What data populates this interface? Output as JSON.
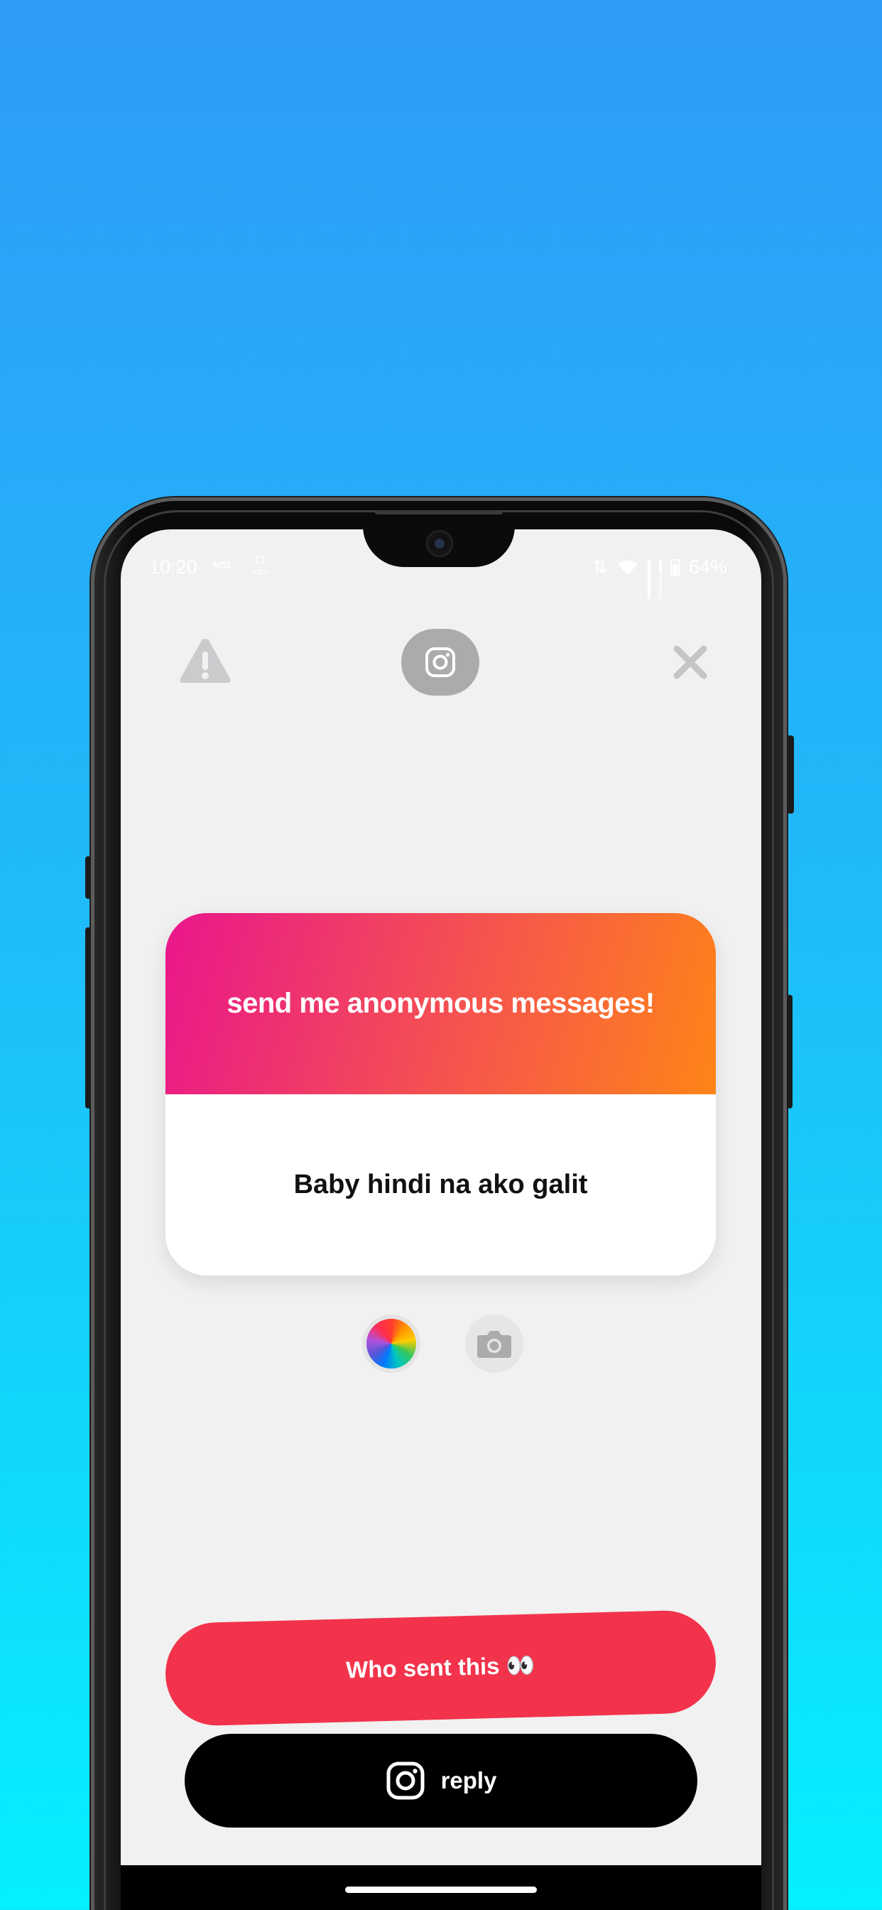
{
  "status_bar": {
    "time": "10:20",
    "network_badge": "NSL",
    "speed_value": "11",
    "speed_unit": "KB/s",
    "battery": "64%"
  },
  "top_bar": {
    "left_icon": "warning-icon",
    "center_icon": "instagram-icon",
    "right_icon": "close-icon"
  },
  "card": {
    "header": "send me anonymous messages!",
    "message": "Baby hindi na ako galit"
  },
  "tools": {
    "color_icon": "color-wheel-icon",
    "photo_icon": "camera-icon"
  },
  "actions": {
    "who_sent": "Who sent this 👀",
    "reply": "reply"
  },
  "colors": {
    "background_top": "#2f9bf7",
    "background_bottom": "#05f0fe",
    "card_gradient_start": "#e9168c",
    "card_gradient_end": "#ff8417",
    "who_button": "#f2334b",
    "reply_button": "#000000"
  }
}
